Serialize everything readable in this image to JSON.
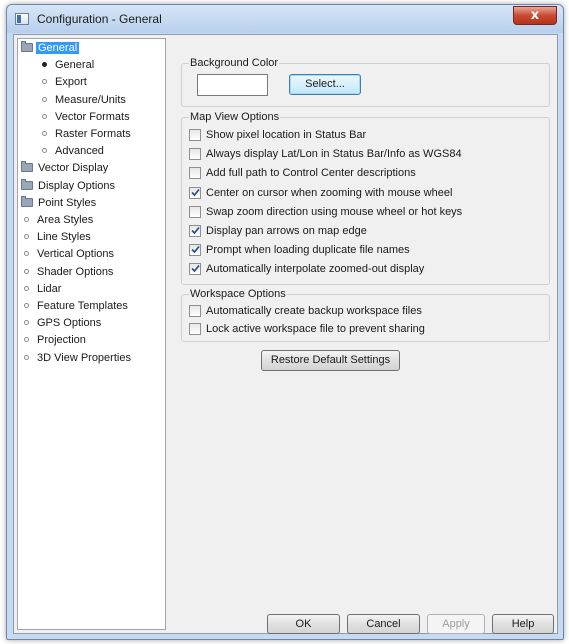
{
  "window": {
    "title": "Configuration - General",
    "close_glyph": "x"
  },
  "tree": {
    "items": [
      {
        "label": "General",
        "icon": "folder-icon",
        "selected": true
      },
      {
        "label": "General",
        "icon": "bullet-filled"
      },
      {
        "label": "Export",
        "icon": "bullet"
      },
      {
        "label": "Measure/Units",
        "icon": "bullet"
      },
      {
        "label": "Vector Formats",
        "icon": "bullet"
      },
      {
        "label": "Raster Formats",
        "icon": "bullet"
      },
      {
        "label": "Advanced",
        "icon": "bullet"
      },
      {
        "label": "Vector Display",
        "icon": "folder-icon"
      },
      {
        "label": "Display Options",
        "icon": "folder-icon"
      },
      {
        "label": "Point Styles",
        "icon": "folder-icon"
      },
      {
        "label": "Area Styles",
        "icon": "bullet"
      },
      {
        "label": "Line Styles",
        "icon": "bullet"
      },
      {
        "label": "Vertical Options",
        "icon": "bullet"
      },
      {
        "label": "Shader Options",
        "icon": "bullet"
      },
      {
        "label": "Lidar",
        "icon": "bullet"
      },
      {
        "label": "Feature Templates",
        "icon": "bullet"
      },
      {
        "label": "GPS Options",
        "icon": "bullet"
      },
      {
        "label": "Projection",
        "icon": "bullet"
      },
      {
        "label": "3D View Properties",
        "icon": "bullet"
      }
    ]
  },
  "background_color": {
    "title": "Background Color",
    "select_label": "Select...",
    "swatch": "#ffffff"
  },
  "map_view": {
    "title": "Map View Options",
    "options": [
      {
        "label": "Show pixel location in Status Bar",
        "checked": false
      },
      {
        "label": "Always display Lat/Lon in Status Bar/Info as WGS84",
        "checked": false
      },
      {
        "label": "Add full path to Control Center descriptions",
        "checked": false
      },
      {
        "label": "Center on cursor when zooming with mouse wheel",
        "checked": true
      },
      {
        "label": "Swap zoom direction using mouse wheel or hot keys",
        "checked": false
      },
      {
        "label": "Display pan arrows on map edge",
        "checked": true
      },
      {
        "label": "Prompt when loading duplicate file names",
        "checked": true
      },
      {
        "label": "Automatically interpolate zoomed-out display",
        "checked": true
      }
    ]
  },
  "workspace": {
    "title": "Workspace Options",
    "options": [
      {
        "label": "Automatically create backup workspace files",
        "checked": false
      },
      {
        "label": "Lock active workspace file to prevent sharing",
        "checked": false
      }
    ]
  },
  "restore_label": "Restore Default Settings",
  "footer": {
    "ok": "OK",
    "cancel": "Cancel",
    "apply": "Apply",
    "help": "Help"
  }
}
